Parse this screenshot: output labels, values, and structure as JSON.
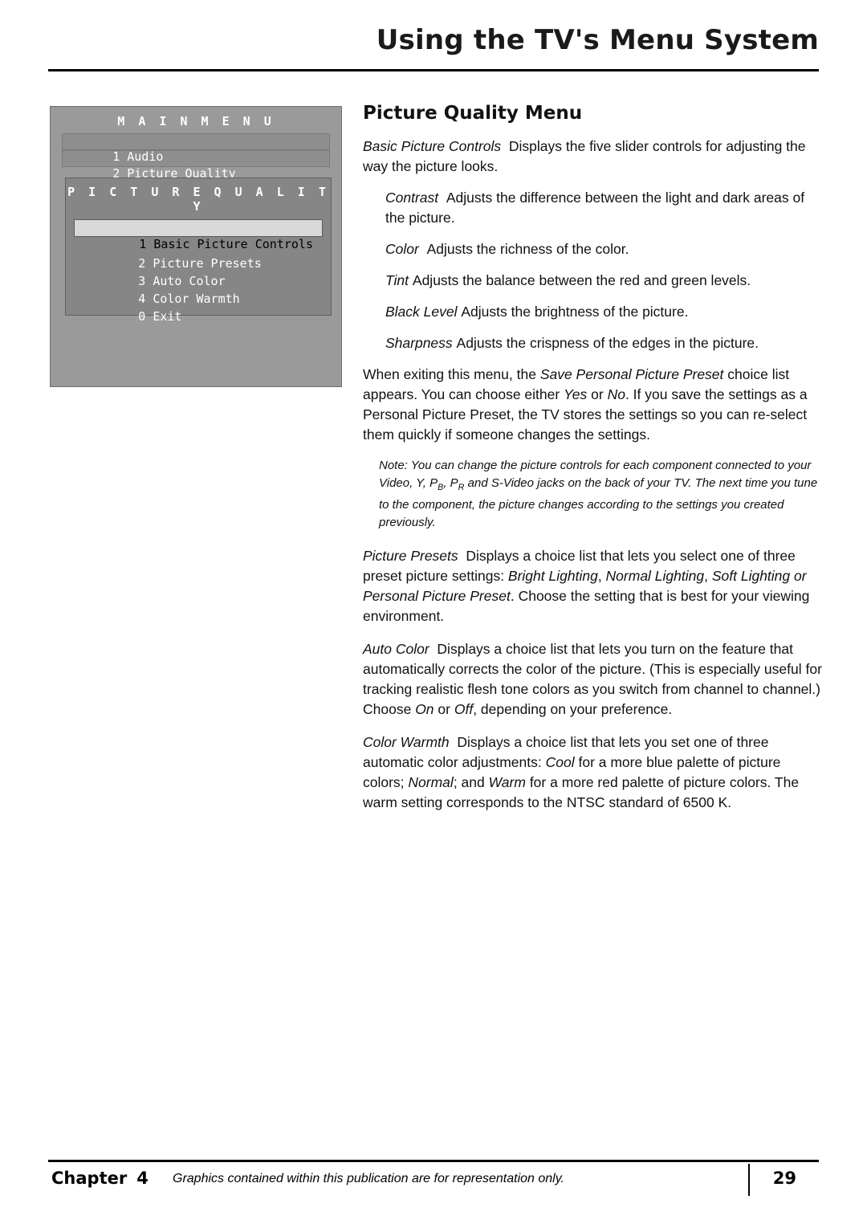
{
  "header": {
    "title": "Using the TV's Menu System"
  },
  "tv_menu": {
    "main_menu_title": "M A I N   M E N U",
    "main_items": [
      {
        "num": "1",
        "label": "Audio",
        "state": "dim"
      },
      {
        "num": "2",
        "label": "Picture Quality",
        "state": "dim"
      }
    ],
    "submenu_title": "P I C T U R E   Q U A L I T Y",
    "submenu_items": [
      {
        "num": "1",
        "label": "Basic Picture Controls",
        "state": "highlight"
      },
      {
        "num": "2",
        "label": "Picture Presets",
        "state": "normal"
      },
      {
        "num": "3",
        "label": "Auto Color",
        "state": "normal"
      },
      {
        "num": "4",
        "label": "Color Warmth",
        "state": "normal"
      },
      {
        "num": "0",
        "label": "Exit",
        "state": "normal"
      }
    ]
  },
  "main": {
    "section_title": "Picture Quality Menu",
    "paragraphs": {
      "basic_picture_controls_term": "Basic Picture Controls",
      "basic_picture_controls_text": "Displays the five slider controls for adjusting the way the picture looks.",
      "contrast_term": "Contrast",
      "contrast_text": "Adjusts the difference between the light and dark areas of the picture.",
      "color_term": "Color",
      "color_text": "Adjusts the richness of the color.",
      "tint_term": "Tint",
      "tint_text": "Adjusts the balance between the red and green levels.",
      "black_level_term": "Black Level",
      "black_level_text": "Adjusts the brightness of the picture.",
      "sharpness_term": "Sharpness",
      "sharpness_text": "Adjusts the crispness of the edges in the picture.",
      "exiting_part1": "When exiting this menu, the ",
      "exiting_italic1": "Save Personal Picture Preset",
      "exiting_part2": " choice list appears. You can choose either ",
      "exiting_italic2": "Yes",
      "exiting_part3": " or ",
      "exiting_italic3": "No",
      "exiting_part4": ". If you save the settings as a Personal Picture Preset, the TV stores the settings so you can re-select them quickly if someone changes the settings.",
      "note_part1": "Note: You can change the picture controls for each component connected to your Video, Y, P",
      "note_sub1": "B",
      "note_part2": ", P",
      "note_sub2": "R",
      "note_part3": " and S-Video jacks on the back of your TV. The next time you tune to the component, the picture changes according to the settings you created previously.",
      "picture_presets_term": "Picture Presets",
      "picture_presets_part1": "Displays a choice list that lets you select one of three preset picture settings: ",
      "picture_presets_italic1": "Bright Lighting",
      "picture_presets_part2": ", ",
      "picture_presets_italic2": "Normal Lighting",
      "picture_presets_part3": ", ",
      "picture_presets_italic3": "Soft Lighting or Personal Picture Preset",
      "picture_presets_part4": ". Choose the setting that is best for your viewing environment.",
      "auto_color_term": "Auto Color",
      "auto_color_part1": "Displays a choice list that lets you turn on the feature that automatically corrects the color of the picture. (This is especially useful for tracking realistic flesh tone colors as you switch from channel to channel.) Choose ",
      "auto_color_italic1": "On",
      "auto_color_part2": " or ",
      "auto_color_italic2": "Off",
      "auto_color_part3": ", depending on your preference.",
      "color_warmth_term": "Color Warmth",
      "color_warmth_part1": "Displays a choice list that lets you set one of three automatic color adjustments: ",
      "color_warmth_italic1": "Cool",
      "color_warmth_part2": " for a more blue palette of picture colors; ",
      "color_warmth_italic2": "Normal",
      "color_warmth_part3": "; and ",
      "color_warmth_italic3": "Warm",
      "color_warmth_part4": " for a more red palette of picture colors. The warm setting corresponds to the NTSC standard of 6500 K."
    }
  },
  "footer": {
    "chapter_label": "Chapter",
    "chapter_number": "4",
    "credit": "Graphics contained within this publication are for representation only.",
    "page_number": "29"
  }
}
